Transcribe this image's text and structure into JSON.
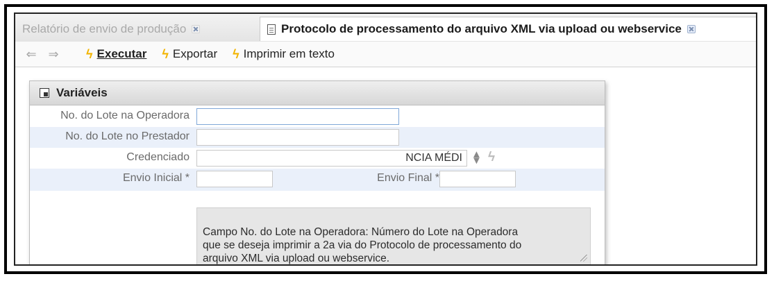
{
  "tabs": [
    {
      "label": "Relatório de envio de produção",
      "active": false
    },
    {
      "label": "Protocolo de processamento do arquivo XML via upload ou webservice",
      "active": true
    }
  ],
  "toolbar": {
    "back_icon": "⇐",
    "forward_icon": "⇒",
    "buttons": [
      {
        "label": "Executar",
        "icon": "lightning-icon"
      },
      {
        "label": "Exportar",
        "icon": "lightning-icon"
      },
      {
        "label": "Imprimir em texto",
        "icon": "lightning-icon"
      }
    ]
  },
  "panel": {
    "title": "Variáveis",
    "fields": {
      "lote_operadora": {
        "label": "No. do Lote na Operadora",
        "value": ""
      },
      "lote_prestador": {
        "label": "No. do Lote no Prestador",
        "value": ""
      },
      "credenciado": {
        "label": "Credenciado",
        "value": "NCIA MÉDI"
      },
      "envio_inicial": {
        "label": "Envio Inicial *",
        "value": ""
      },
      "envio_final": {
        "label": "Envio Final *",
        "value": ""
      }
    },
    "help_text": "Campo No. do Lote na Operadora: Número do Lote na Operadora\nque se deseja imprimir a 2a via do Protocolo de processamento do\narquivo XML via upload ou webservice."
  },
  "colors": {
    "accent_bolt": "#f2b400",
    "row_alt": "#eaf0fa",
    "focus_border": "#7fa7d8"
  }
}
